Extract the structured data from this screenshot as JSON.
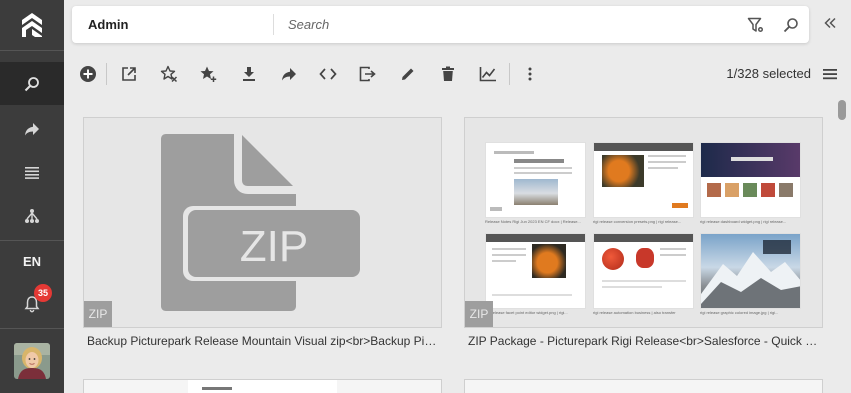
{
  "sidebar": {
    "items": [
      {
        "name": "search",
        "icon": "search-icon"
      },
      {
        "name": "share",
        "icon": "share-icon"
      },
      {
        "name": "list",
        "icon": "list-icon"
      },
      {
        "name": "hierarchy",
        "icon": "hierarchy-icon"
      }
    ],
    "language": "EN",
    "notifications_count": "35"
  },
  "search": {
    "channel": "Admin",
    "placeholder": "Search"
  },
  "toolbar": {
    "icons": [
      "add-icon",
      "open-external-icon",
      "star-remove-icon",
      "star-add-icon",
      "download-icon",
      "share-icon",
      "embed-code-icon",
      "export-icon",
      "edit-icon",
      "delete-icon",
      "statistics-icon",
      "more-icon"
    ],
    "selected_label": "1/328 selected"
  },
  "results": [
    {
      "title": "Backup Picturepark Release Mountain Visual zip<br>Backup Picturepark Release Mountain Visual zip",
      "type": "ZIP",
      "thumb_icon": "zip-file-icon"
    },
    {
      "title": "ZIP Package - Picturepark Rigi Release<br>Salesforce - Quick View",
      "type": "ZIP",
      "previews": [
        "Release Notes Rigi Jun 2023 EN CF docx | Release...",
        "rigi release conversion presets.png | rigi release...",
        "rigi release dashboard widget.png | rigi release...",
        "rigi release facet point editor widget.png | rigi...",
        "rigi release automation business | also transfer",
        "rigi release graphic colored image.jpg | rigi..."
      ]
    }
  ],
  "colors": {
    "rail": "#3c3c3c",
    "rail_active": "#2a2a2a",
    "badge": "#e53935",
    "zip_icon": "#9e9e9e"
  }
}
